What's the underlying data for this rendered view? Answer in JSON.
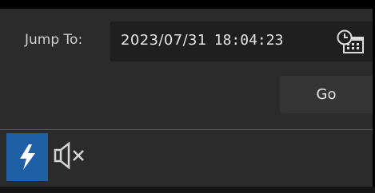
{
  "jump_to": {
    "label": "Jump To:",
    "date": "2023/07/31",
    "time": "18:04:23"
  },
  "go_button": {
    "label": "Go"
  },
  "toolbar": {
    "icons": [
      "lightning-icon",
      "speaker-muted-icon",
      "calendar-clock-icon"
    ],
    "active_color": "#1e5fa6"
  },
  "colors": {
    "panel_bg": "#2b2b2b",
    "field_bg": "#1f1f1f",
    "button_bg": "#353535",
    "text": "#e4e4e4"
  }
}
